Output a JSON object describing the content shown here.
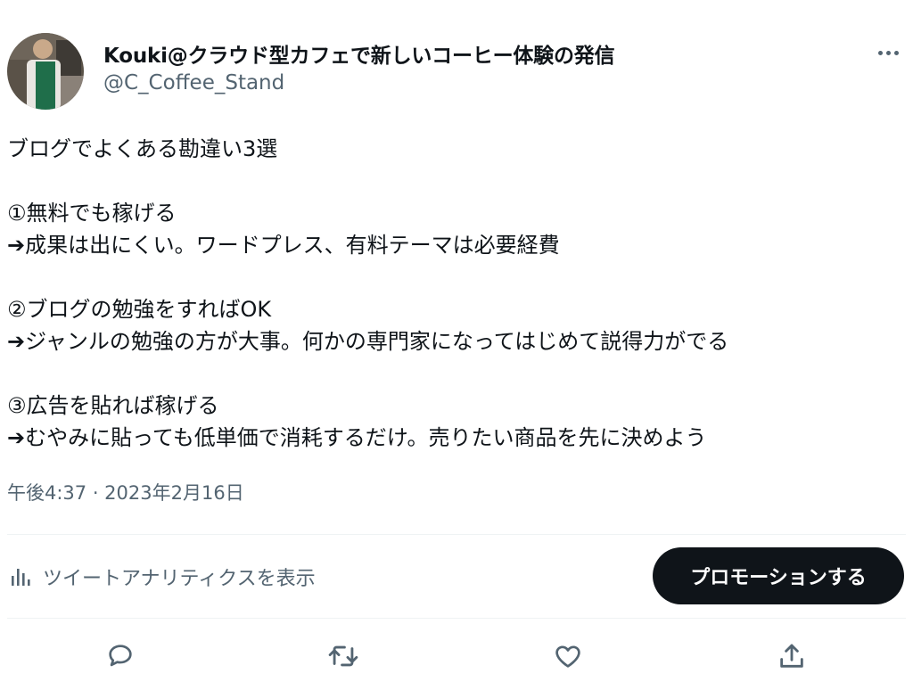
{
  "tweet": {
    "author": {
      "display_name": "Kouki@クラウド型カフェで新しいコーヒー体験の発信",
      "handle": "@C_Coffee_Stand"
    },
    "text_lines": [
      "ブログでよくある勘違い3選",
      "",
      "①無料でも稼げる",
      "➔成果は出にくい。ワードプレス、有料テーマは必要経費",
      "",
      "②ブログの勉強をすればOK",
      "➔ジャンルの勉強の方が大事。何かの専門家になってはじめて説得力がでる",
      "",
      "③広告を貼れば稼げる",
      "➔むやみに貼っても低単価で消耗するだけ。売りたい商品を先に決めよう"
    ],
    "timestamp": "午後4:37 · 2023年2月16日"
  },
  "analytics": {
    "label": "ツイートアナリティクスを表示",
    "icon": "bar-chart-icon"
  },
  "promote_button": {
    "label": "プロモーションする"
  },
  "actions": [
    {
      "name": "reply-button",
      "icon": "reply-icon"
    },
    {
      "name": "retweet-button",
      "icon": "retweet-icon"
    },
    {
      "name": "like-button",
      "icon": "heart-icon"
    },
    {
      "name": "share-button",
      "icon": "share-icon"
    }
  ],
  "colors": {
    "text_primary": "#0f1419",
    "text_secondary": "#536471",
    "divider": "#eff3f4",
    "button_bg": "#0f1419"
  }
}
